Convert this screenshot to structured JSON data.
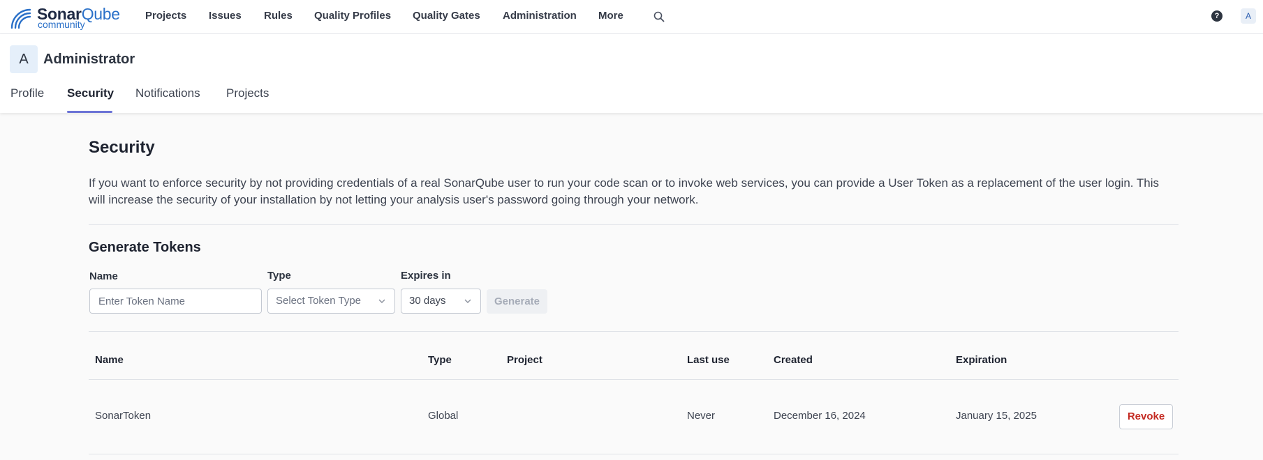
{
  "brand": {
    "name_part1": "Sonar",
    "name_part2": "Qube",
    "edition": "community"
  },
  "nav": {
    "items": [
      {
        "label": "Projects"
      },
      {
        "label": "Issues"
      },
      {
        "label": "Rules"
      },
      {
        "label": "Quality Profiles"
      },
      {
        "label": "Quality Gates"
      },
      {
        "label": "Administration"
      },
      {
        "label": "More"
      }
    ],
    "help_glyph": "?",
    "user_initial": "A",
    "icons": [
      "search-icon",
      "help-icon"
    ]
  },
  "account": {
    "avatar_initial": "A",
    "name": "Administrator",
    "tabs": [
      {
        "label": "Profile"
      },
      {
        "label": "Security",
        "active": true
      },
      {
        "label": "Notifications"
      },
      {
        "label": "Projects"
      }
    ]
  },
  "security": {
    "title": "Security",
    "description": "If you want to enforce security by not providing credentials of a real SonarQube user to run your code scan or to invoke web services, you can provide a User Token as a replacement of the user login. This will increase the security of your installation by not letting your analysis user's password going through your network."
  },
  "generate": {
    "title": "Generate Tokens",
    "name_label": "Name",
    "name_placeholder": "Enter Token Name",
    "type_label": "Type",
    "type_placeholder": "Select Token Type",
    "expires_label": "Expires in",
    "expires_value": "30 days",
    "generate_button": "Generate"
  },
  "tokens_table": {
    "headers": [
      "Name",
      "Type",
      "Project",
      "Last use",
      "Created",
      "Expiration"
    ],
    "rows": [
      {
        "name": "SonarToken",
        "type": "Global",
        "project": "",
        "last_use": "Never",
        "created": "December 16, 2024",
        "expiration": "January 15, 2025",
        "action": "Revoke"
      }
    ]
  },
  "colors": {
    "accent": "#6b72d6",
    "brand_blue": "#2a70c8",
    "danger": "#c42b23"
  }
}
